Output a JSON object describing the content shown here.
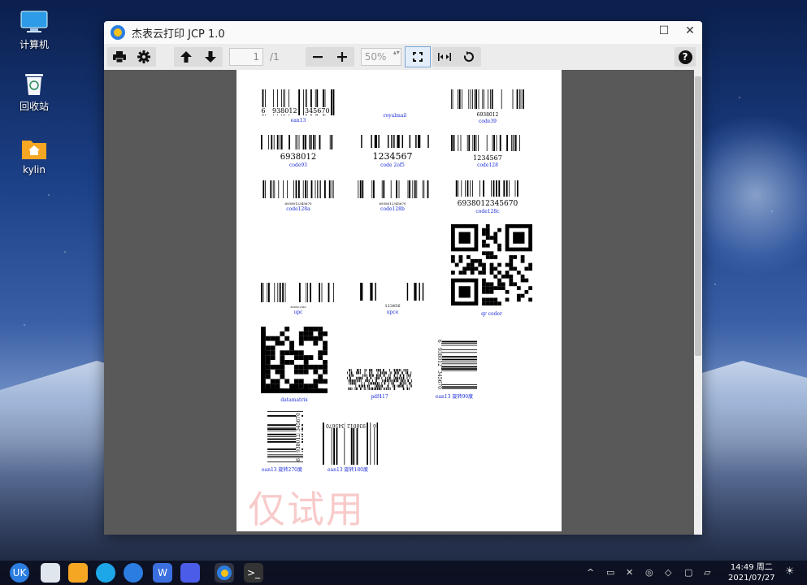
{
  "desktop": {
    "icons": [
      {
        "label": "计算机",
        "icon": "computer-icon"
      },
      {
        "label": "回收站",
        "icon": "trash-icon"
      },
      {
        "label": "kylin",
        "icon": "home-folder-icon"
      }
    ]
  },
  "window": {
    "title": "杰表云打印 JCP 1.0",
    "controls": {
      "maximize": "☐",
      "close": "✕"
    }
  },
  "toolbar": {
    "print_icon": "print-icon",
    "settings_icon": "gear-icon",
    "page_current": "1",
    "page_total": "/1",
    "zoom_value": "50%",
    "help_glyph": "?"
  },
  "document": {
    "barcodes": [
      {
        "name": "ean13",
        "digits_left": "6",
        "digits_mid": "938012",
        "digits_right": "345670"
      },
      {
        "name": "royalmail"
      },
      {
        "name": "code39",
        "text": "6938012"
      },
      {
        "name": "code93",
        "text": "6938012"
      },
      {
        "name": "code 2of5",
        "text": "1234567"
      },
      {
        "name": "code128",
        "text": "1234567"
      },
      {
        "name": "code128a",
        "text": "6938012345670"
      },
      {
        "name": "code128b",
        "text": "6938012345670"
      },
      {
        "name": "code128c",
        "text": "6938012345670"
      },
      {
        "name": "upc",
        "text": "6938012345"
      },
      {
        "name": "upce",
        "text": "123456"
      },
      {
        "name": "qr coder"
      },
      {
        "name": "datamatrix"
      },
      {
        "name": "pdf417"
      },
      {
        "name": "ean13 旋转90度",
        "digits_left": "6",
        "digits_mid": "938012",
        "digits_right": "345670"
      },
      {
        "name": "ean13 旋转270度",
        "digits_left": "6",
        "digits_mid": "938012",
        "digits_right": "345670"
      },
      {
        "name": "ean13 旋转180度",
        "digits_left": "6",
        "digits_mid": "938012",
        "digits_right": "345670"
      }
    ],
    "watermark": "仅试用"
  },
  "taskbar": {
    "time": "14:49 周二",
    "date": "2021/07/27"
  }
}
